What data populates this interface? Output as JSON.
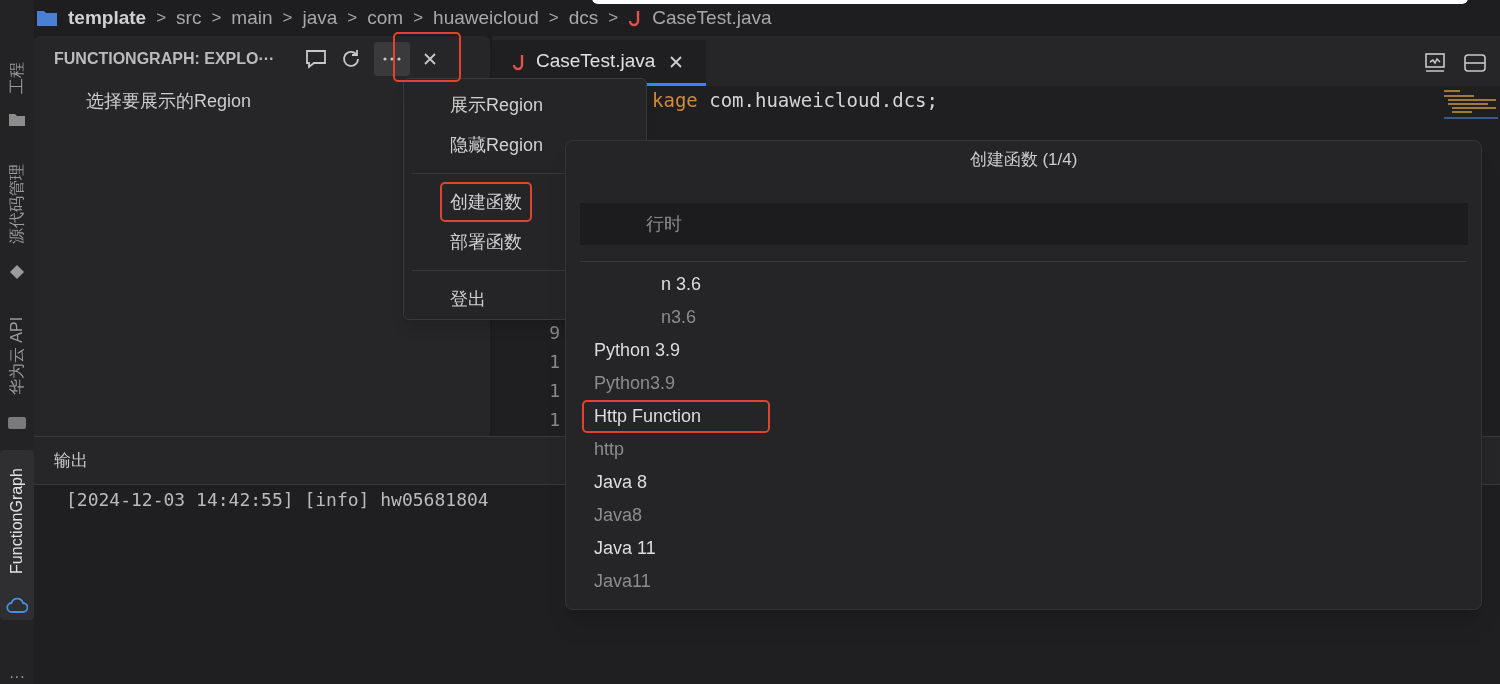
{
  "breadcrumb": {
    "items": [
      {
        "kind": "folder",
        "label": "template",
        "sep": ">"
      },
      {
        "kind": "plain",
        "label": "src",
        "sep": ">"
      },
      {
        "kind": "plain",
        "label": "main",
        "sep": ">"
      },
      {
        "kind": "plain",
        "label": "java",
        "sep": ">"
      },
      {
        "kind": "plain",
        "label": "com",
        "sep": ">"
      },
      {
        "kind": "plain",
        "label": "huaweicloud",
        "sep": ">"
      },
      {
        "kind": "plain",
        "label": "dcs",
        "sep": ">"
      },
      {
        "kind": "java",
        "label": "CaseTest.java"
      }
    ]
  },
  "activity_bar": {
    "items": [
      {
        "kind": "folder",
        "label": "工程",
        "selected": false
      },
      {
        "kind": "git",
        "label": "源代码管理",
        "selected": false
      },
      {
        "kind": "api",
        "label": "华为云 API",
        "selected": false
      },
      {
        "kind": "cloud",
        "label": "FunctionGraph",
        "selected": true
      }
    ],
    "more": "···"
  },
  "sidebar": {
    "title": "FUNCTIONGRAPH: EXPLO···",
    "more_highlighted": true,
    "message": "选择要展示的Region"
  },
  "editor": {
    "tab": {
      "label": "CaseTest.java",
      "selected": true
    },
    "code_line": {
      "keyword": "kage",
      "rest": " com.huaweicloud.dcs;"
    },
    "line_numbers": [
      "9",
      "1",
      "1",
      "1"
    ]
  },
  "context_menu": {
    "groups": [
      [
        {
          "label": "展示Region",
          "highlighted": false
        },
        {
          "label": "隐藏Region",
          "highlighted": false
        }
      ],
      [
        {
          "label": "创建函数",
          "highlighted": true
        },
        {
          "label": "部署函数",
          "highlighted": false
        }
      ],
      [
        {
          "label": "登出",
          "highlighted": false
        }
      ]
    ]
  },
  "quick_pick": {
    "title": "创建函数 (1/4)",
    "placeholder": "行时",
    "items": [
      {
        "kind": "covered",
        "label": "n 3.6",
        "description": "n3.6",
        "highlighted": false
      },
      {
        "kind": "full",
        "label": "Python 3.9",
        "description": "Python3.9",
        "highlighted": false
      },
      {
        "kind": "full",
        "label": "Http Function",
        "description": "http",
        "highlighted": true
      },
      {
        "kind": "full",
        "label": "Java 8",
        "description": "Java8",
        "highlighted": false
      },
      {
        "kind": "full",
        "label": "Java 11",
        "description": "Java11",
        "highlighted": false
      }
    ]
  },
  "output": {
    "title": "输出",
    "lines": [
      "[2024-12-03 14:42:55] [info] hw05681804"
    ]
  }
}
